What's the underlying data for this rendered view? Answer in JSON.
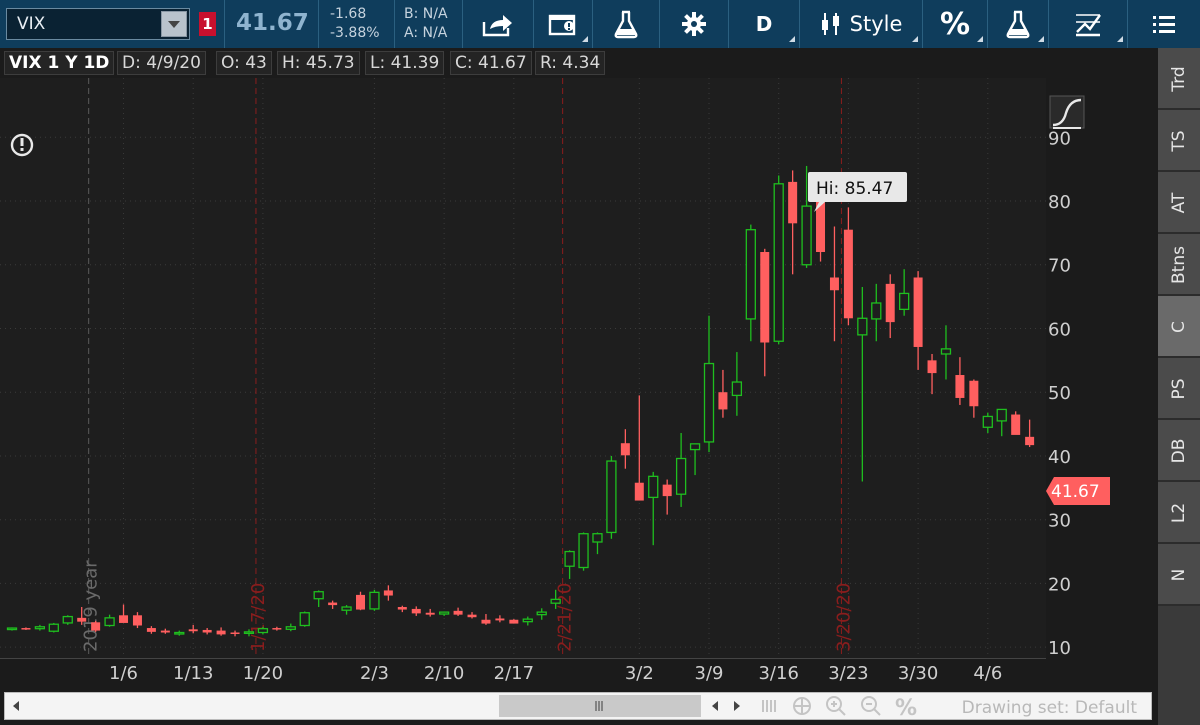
{
  "toolbar": {
    "symbol": "VIX",
    "link_badge": "1",
    "last_price": "41.67",
    "net_change": "-1.68",
    "pct_change": "-3.88%",
    "bid": "B: N/A",
    "ask": "A: N/A",
    "aggregation": "D",
    "style_label": "Style",
    "percent_label": "%",
    "icons": [
      "share-icon",
      "flask-icon",
      "gear-icon",
      "studies-icon",
      "drawing-icon",
      "menu-icon"
    ]
  },
  "header": {
    "title": "VIX 1 Y 1D",
    "date": "D: 4/9/20",
    "open": "O: 43",
    "high": "H: 45.73",
    "low": "L: 41.39",
    "close": "C: 41.67",
    "range": "R: 4.34"
  },
  "hi_bubble": "Hi: 85.47",
  "price_tag": "41.67",
  "side_tabs": [
    "Trd",
    "TS",
    "AT",
    "Btns",
    "C",
    "PS",
    "DB",
    "L2",
    "N"
  ],
  "drawing_set": "Drawing set: Default",
  "colors": {
    "up": "#1fbf1f",
    "down": "#ff5f5f",
    "marker": "#8a1d1d",
    "toolbar": "#0f3d5c",
    "tag": "#ff5f5f"
  },
  "chart_data": {
    "type": "candlestick",
    "ylim": [
      8.3,
      99.3
    ],
    "yticks": [
      10,
      20,
      30,
      40,
      50,
      60,
      70,
      80,
      90
    ],
    "xticks": [
      "1/6",
      "1/13",
      "1/20",
      "2/3",
      "2/10",
      "2/17",
      "3/2",
      "3/9",
      "3/16",
      "3/23",
      "3/30",
      "4/6"
    ],
    "xtick_index": [
      8,
      13,
      18,
      26,
      31,
      36,
      45,
      50,
      55,
      60,
      65,
      70
    ],
    "markers": [
      {
        "label": "2019 year",
        "index": 5.5,
        "style": "gray"
      },
      {
        "label": "1/17/20",
        "index": 17.5,
        "style": "red"
      },
      {
        "label": "2/21/20",
        "index": 39.5,
        "style": "red"
      },
      {
        "label": "3/20/20",
        "index": 59.5,
        "style": "red"
      }
    ],
    "candles": [
      [
        12.8,
        13.1,
        12.6,
        13.0
      ],
      [
        13.0,
        13.1,
        12.7,
        12.8
      ],
      [
        12.9,
        13.5,
        12.6,
        13.2
      ],
      [
        12.5,
        13.8,
        12.3,
        13.6
      ],
      [
        13.8,
        15.0,
        13.5,
        14.8
      ],
      [
        14.6,
        16.3,
        13.5,
        14.0
      ],
      [
        13.9,
        14.1,
        12.4,
        12.6
      ],
      [
        13.4,
        15.1,
        13.2,
        14.6
      ],
      [
        15.0,
        16.7,
        14.2,
        13.8
      ],
      [
        15.0,
        15.5,
        13.0,
        13.4
      ],
      [
        13.0,
        13.3,
        12.1,
        12.4
      ],
      [
        12.6,
        12.9,
        12.1,
        12.3
      ],
      [
        12.1,
        12.6,
        11.8,
        12.3
      ],
      [
        12.8,
        13.5,
        12.2,
        12.5
      ],
      [
        12.7,
        13.0,
        12.0,
        12.3
      ],
      [
        12.6,
        13.1,
        11.8,
        12.0
      ],
      [
        12.3,
        12.6,
        11.7,
        12.1
      ],
      [
        12.2,
        12.8,
        11.7,
        12.4
      ],
      [
        12.3,
        13.2,
        12.0,
        12.9
      ],
      [
        13.0,
        13.2,
        12.6,
        12.8
      ],
      [
        12.8,
        13.7,
        12.5,
        13.2
      ],
      [
        13.4,
        15.6,
        13.2,
        15.4
      ],
      [
        17.6,
        18.9,
        16.3,
        18.7
      ],
      [
        17.0,
        17.3,
        16.0,
        16.6
      ],
      [
        15.8,
        16.6,
        15.1,
        16.3
      ],
      [
        18.2,
        18.7,
        15.8,
        15.9
      ],
      [
        16.0,
        19.0,
        15.7,
        18.6
      ],
      [
        18.9,
        19.7,
        17.3,
        18.1
      ],
      [
        16.3,
        16.5,
        15.5,
        15.9
      ],
      [
        16.0,
        16.4,
        14.9,
        15.3
      ],
      [
        15.4,
        16.0,
        14.8,
        15.1
      ],
      [
        15.2,
        15.6,
        14.9,
        15.5
      ],
      [
        15.7,
        16.2,
        14.9,
        15.1
      ],
      [
        15.1,
        15.5,
        14.5,
        14.7
      ],
      [
        14.3,
        15.2,
        13.5,
        13.7
      ],
      [
        14.5,
        15.0,
        13.9,
        14.2
      ],
      [
        14.3,
        14.4,
        13.8,
        13.7
      ],
      [
        14.0,
        14.8,
        13.4,
        14.4
      ],
      [
        15.1,
        16.1,
        14.3,
        15.5
      ],
      [
        16.9,
        19.0,
        16.0,
        17.5
      ],
      [
        22.7,
        25.2,
        20.7,
        25.0
      ],
      [
        22.5,
        28.0,
        22.0,
        27.8
      ],
      [
        26.5,
        28.0,
        24.6,
        27.8
      ],
      [
        28.0,
        40.0,
        27.0,
        39.2
      ],
      [
        42.0,
        44.2,
        38.0,
        40.1
      ],
      [
        35.8,
        49.5,
        33.2,
        33.0
      ],
      [
        33.5,
        37.5,
        26.0,
        36.8
      ],
      [
        35.5,
        36.3,
        30.8,
        33.7
      ],
      [
        34.0,
        43.6,
        32.0,
        39.6
      ],
      [
        41.0,
        41.9,
        37.0,
        41.9
      ],
      [
        42.2,
        62.0,
        40.6,
        54.5
      ],
      [
        50.0,
        53.5,
        46.0,
        47.3
      ],
      [
        49.5,
        56.3,
        46.3,
        51.6
      ],
      [
        61.5,
        76.3,
        58.0,
        75.5
      ],
      [
        72.0,
        72.5,
        52.5,
        57.8
      ],
      [
        58.0,
        84.0,
        57.5,
        82.7
      ],
      [
        83.0,
        84.8,
        68.5,
        76.5
      ],
      [
        70.0,
        85.5,
        69.5,
        79.2
      ],
      [
        81.0,
        84.0,
        70.5,
        72.0
      ],
      [
        68.0,
        76.0,
        58.0,
        66.0
      ],
      [
        75.5,
        79.0,
        60.5,
        61.6
      ],
      [
        59.0,
        66.5,
        36.0,
        61.6
      ],
      [
        61.5,
        67.0,
        58.0,
        64.0
      ],
      [
        67.0,
        68.5,
        58.5,
        61.0
      ],
      [
        63.0,
        69.3,
        62.0,
        65.5
      ],
      [
        68.0,
        69.0,
        53.5,
        57.1
      ],
      [
        55.0,
        56.0,
        49.7,
        53.0
      ],
      [
        56.0,
        60.5,
        52.0,
        56.8
      ],
      [
        52.7,
        55.5,
        48.0,
        49.1
      ],
      [
        51.8,
        52.0,
        46.0,
        47.8
      ],
      [
        44.5,
        46.8,
        43.6,
        46.2
      ],
      [
        45.5,
        47.3,
        43.1,
        47.3
      ],
      [
        46.5,
        47.0,
        44.8,
        43.3
      ],
      [
        43.0,
        45.7,
        41.4,
        41.7
      ]
    ]
  }
}
